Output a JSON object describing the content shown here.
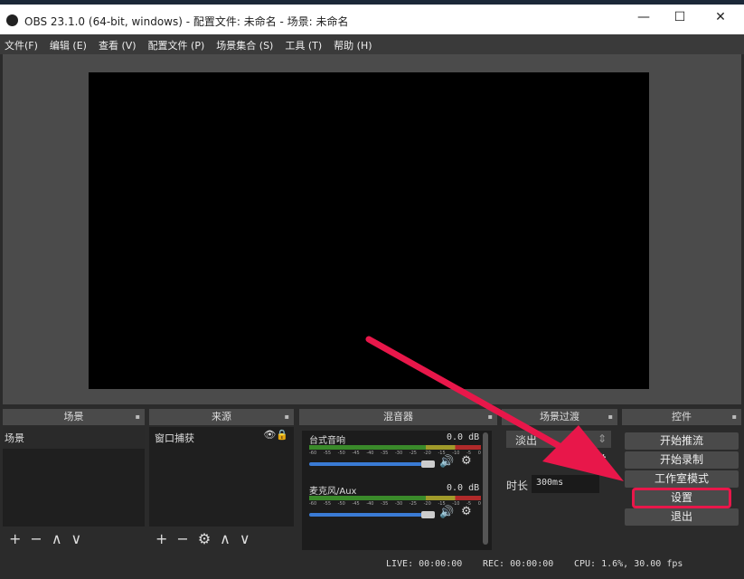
{
  "title": "OBS 23.1.0 (64-bit, windows) - 配置文件: 未命名 - 场景: 未命名",
  "window_controls": [
    "—",
    "☐",
    "✕"
  ],
  "menu": [
    "文件(F)",
    "编辑 (E)",
    "查看 (V)",
    "配置文件 (P)",
    "场景集合 (S)",
    "工具 (T)",
    "帮助 (H)"
  ],
  "docks": {
    "scenes": {
      "title": "场景",
      "items": [
        "场景"
      ]
    },
    "sources": {
      "title": "来源",
      "items": [
        "窗口捕获"
      ]
    },
    "mixer": {
      "title": "混音器",
      "channels": [
        {
          "name": "台式音响",
          "db": "0.0 dB"
        },
        {
          "name": "麦克风/Aux",
          "db": "0.0 dB"
        }
      ],
      "ticks": [
        "-60",
        "-55",
        "-50",
        "-45",
        "-40",
        "-35",
        "-30",
        "-25",
        "-20",
        "-15",
        "-10",
        "-5",
        "0"
      ]
    },
    "transitions": {
      "title": "场景过渡",
      "selected": "淡出",
      "duration_label": "时长",
      "duration": "300ms"
    },
    "controls": {
      "title": "控件",
      "buttons": [
        "开始推流",
        "开始录制",
        "工作室模式",
        "设置",
        "退出"
      ]
    }
  },
  "status": {
    "live": "LIVE: 00:00:00",
    "rec": "REC: 00:00:00",
    "cpu": "CPU: 1.6%, 30.00 fps"
  },
  "toolbar_icons": {
    "add": "+",
    "remove": "−",
    "up": "∧",
    "down": "∨",
    "gear": "⚙"
  },
  "accent": "#e8174a"
}
